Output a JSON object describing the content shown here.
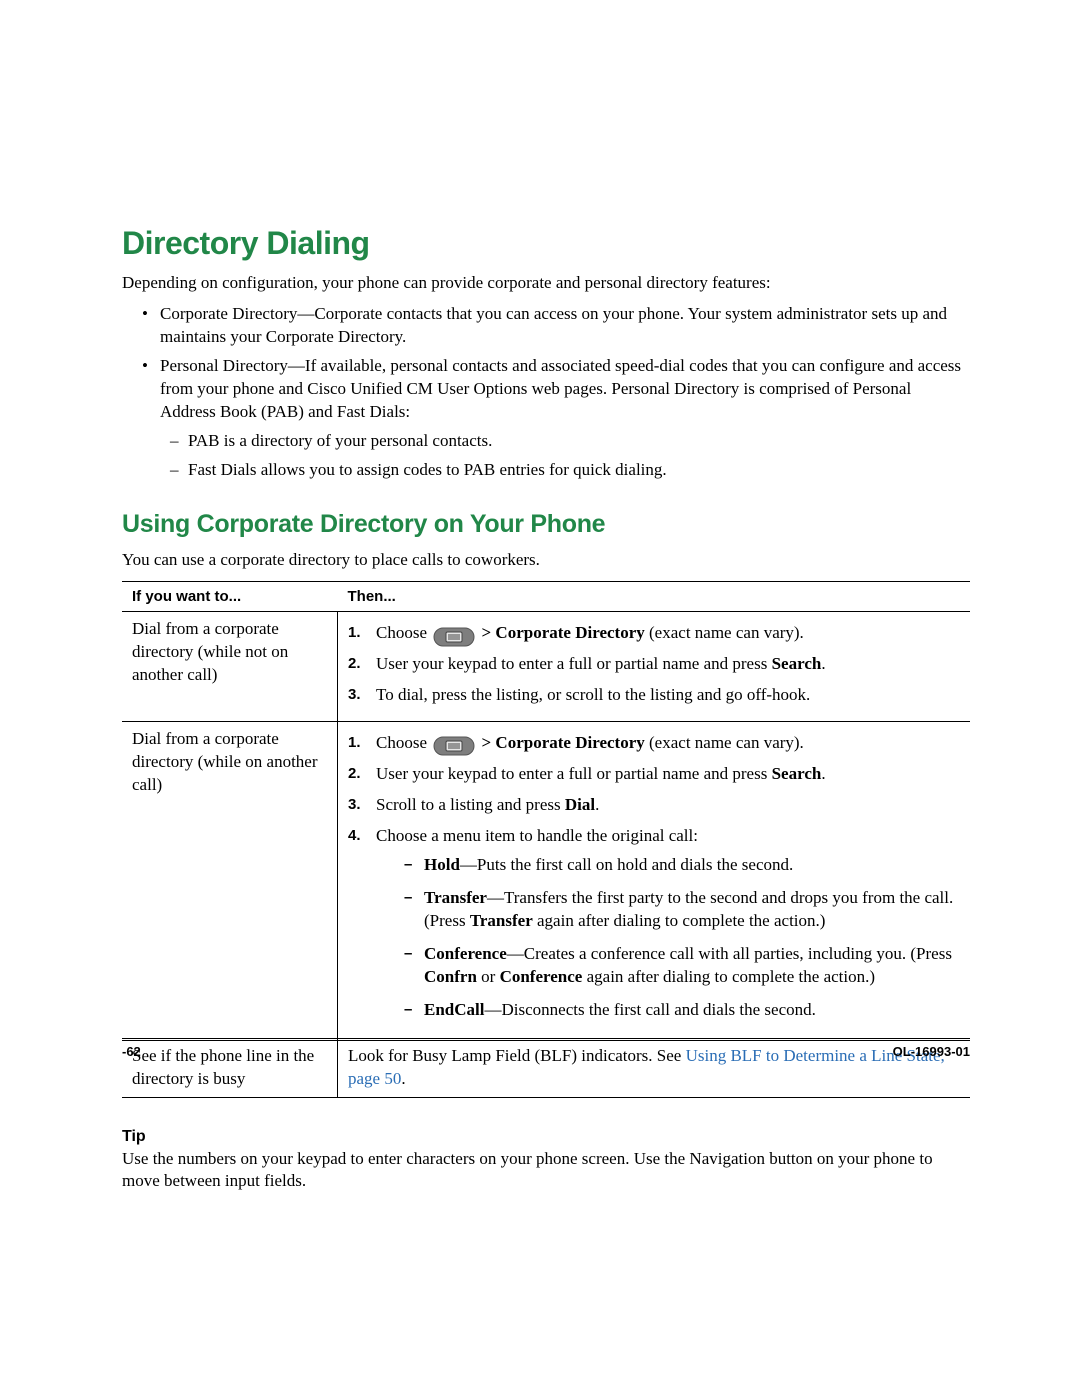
{
  "h1": "Directory Dialing",
  "intro": "Depending on configuration, your phone can provide corporate and personal directory features:",
  "bullets": {
    "corp": "Corporate Directory—Corporate contacts that you can access on your phone. Your system administrator sets up and maintains your Corporate Directory.",
    "pers": "Personal Directory—If available, personal contacts and associated speed-dial codes that you can configure and access from your phone and Cisco Unified CM User Options web pages. Personal Directory is comprised of Personal Address Book (PAB) and Fast Dials:",
    "sub1": "PAB is a directory of your personal contacts.",
    "sub2": "Fast Dials allows you to assign codes to PAB entries for quick dialing."
  },
  "h2": "Using Corporate Directory on Your Phone",
  "p2": "You can use a corporate directory to place calls to coworkers.",
  "th1": "If you want to...",
  "th2": "Then...",
  "row1": {
    "left": "Dial from a corporate directory (while not on another call)",
    "s1a": "Choose ",
    "s1b": " > Corporate Directory",
    "s1c": " (exact name can vary).",
    "s2a": "User your keypad to enter a full or partial name and press ",
    "s2b": "Search",
    "s2c": ".",
    "s3": "To dial, press the listing, or scroll to the listing and go off-hook."
  },
  "row2": {
    "left": "Dial from a corporate directory (while on another call)",
    "s1a": "Choose ",
    "s1b": " > Corporate Directory",
    "s1c": " (exact name can vary).",
    "s2a": "User your keypad to enter a full or partial name and press ",
    "s2b": "Search",
    "s2c": ".",
    "s3a": "Scroll to a listing and press ",
    "s3b": "Dial",
    "s3c": ".",
    "s4": "Choose a menu item to handle the original call:",
    "d1a": "Hold",
    "d1b": "—Puts the first call on hold and dials the second.",
    "d2a": "Transfer",
    "d2b": "—Transfers the first party to the second and drops you from the call. (Press ",
    "d2c": "Transfer",
    "d2d": " again after dialing to complete the action.)",
    "d3a": "Conference",
    "d3b": "—Creates a conference call with all parties, including you. (Press ",
    "d3c": "Confrn",
    "d3d": " or ",
    "d3e": "Conference",
    "d3f": " again after dialing to complete the action.)",
    "d4a": "EndCall",
    "d4b": "—Disconnects the first call and dials the second."
  },
  "row3": {
    "left": "See if the phone line in the directory is busy",
    "r1": "Look for Busy Lamp Field (BLF) indicators. See ",
    "link": "Using BLF to Determine a Line State, page 50",
    "r2": "."
  },
  "tip_h": "Tip",
  "tip": "Use the numbers on your keypad to enter characters on your phone screen. Use the Navigation button on your phone to move between input fields.",
  "footer": {
    "page": "-62",
    "doc": "OL-16993-01"
  }
}
